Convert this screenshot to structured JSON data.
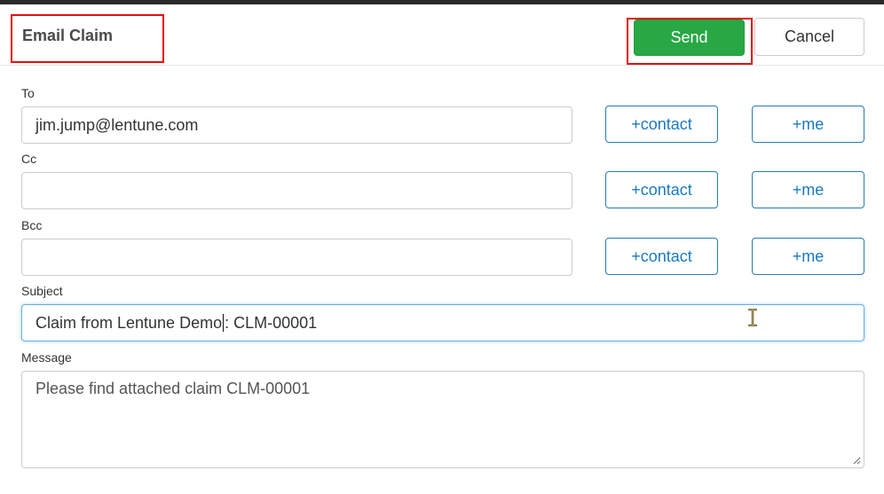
{
  "dialog": {
    "title": "Email Claim",
    "send_label": "Send",
    "cancel_label": "Cancel"
  },
  "fields": {
    "to": {
      "label": "To",
      "value": "jim.jump@lentune.com"
    },
    "cc": {
      "label": "Cc",
      "value": ""
    },
    "bcc": {
      "label": "Bcc",
      "value": ""
    },
    "subject": {
      "label": "Subject",
      "value_before_caret": "Claim from Lentune Demo",
      "value_after_caret": ": CLM-00001"
    },
    "message": {
      "label": "Message",
      "value": "Please find attached claim CLM-00001"
    }
  },
  "buttons": {
    "contact_label": "+contact",
    "me_label": "+me"
  },
  "colors": {
    "send": "#28a745",
    "outline": "#1a7ac0",
    "highlight": "#e01010"
  }
}
